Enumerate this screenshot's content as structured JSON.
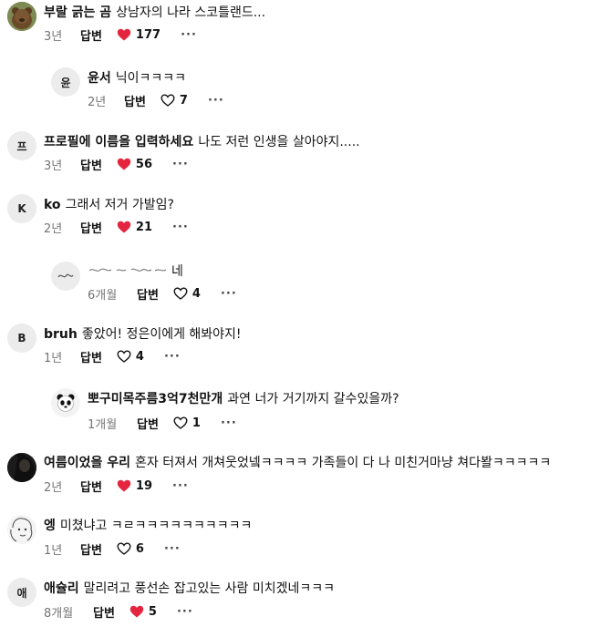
{
  "labels": {
    "reply": "답변",
    "more": "···"
  },
  "colors": {
    "liked": "#e5253f",
    "accent": "#121212",
    "muted": "#757575"
  },
  "comments": [
    {
      "name": "부랄 긁는 곰",
      "text": "상남자의 나라 스코틀랜드...",
      "age": "3년",
      "likes": "177",
      "liked": true,
      "avatar": "bear-photo-avatar",
      "initial": ""
    },
    {
      "name": "윤서",
      "text": "닉이ㅋㅋㅋㅋ",
      "age": "2년",
      "likes": "7",
      "liked": false,
      "avatar": "letter-avatar",
      "initial": "윤"
    },
    {
      "name": "프로필에 이름을 입력하세요",
      "text": "나도 저런 인생을 살아야지.....",
      "age": "3년",
      "likes": "56",
      "liked": true,
      "avatar": "letter-avatar",
      "initial": "프"
    },
    {
      "name": "ko",
      "text": "그래서 저거 가발임?",
      "age": "2년",
      "likes": "21",
      "liked": true,
      "avatar": "letter-avatar",
      "initial": "K"
    },
    {
      "name": "",
      "text": "네",
      "age": "6개월",
      "likes": "4",
      "liked": false,
      "avatar": "scribble-avatar",
      "initial": ""
    },
    {
      "name": "bruh",
      "text": "좋았어! 정은이에게 해봐야지!",
      "age": "1년",
      "likes": "4",
      "liked": false,
      "avatar": "letter-avatar",
      "initial": "B"
    },
    {
      "name": "뽀구미목주름3억7천만개",
      "text": "과연 너가 거기까지 갈수있을까?",
      "age": "1개월",
      "likes": "1",
      "liked": false,
      "avatar": "panda-avatar",
      "initial": ""
    },
    {
      "name": "여름이었을 우리",
      "text": "혼자 터져서 개쳐웃었넼ㅋㅋㅋㅋ 가족들이 다 나 미친거마냥 쳐다봘ㅋㅋㅋㅋㅋ",
      "age": "2년",
      "likes": "19",
      "liked": true,
      "avatar": "dark-photo-avatar",
      "initial": ""
    },
    {
      "name": "엥",
      "text": "미쳤냐고 ㅋㄹㅋㅋㅋㅋㅋㅋㅋㅋㅋㅋ",
      "age": "1년",
      "likes": "6",
      "liked": false,
      "avatar": "sketch-avatar",
      "initial": ""
    },
    {
      "name": "애슐리",
      "text": "말리려고 풍선손 잡고있는 사람 미치겠네ㅋㅋㅋ",
      "age": "8개월",
      "likes": "5",
      "liked": true,
      "avatar": "letter-avatar",
      "initial": "애"
    }
  ]
}
